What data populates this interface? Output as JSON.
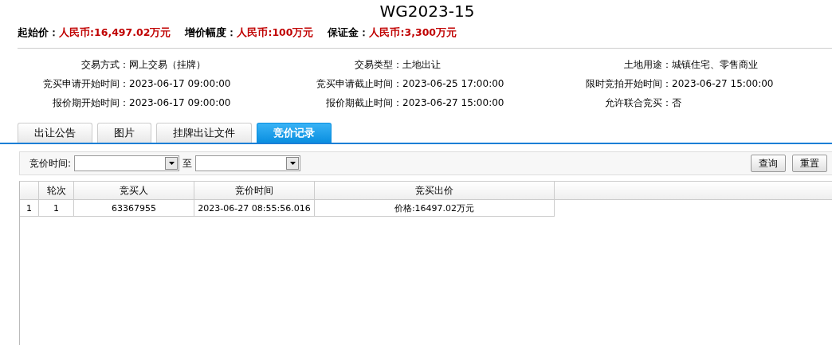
{
  "title": "WG2023-15",
  "prices": [
    {
      "label": "起始价：",
      "value": "人民币:16,497.02万元"
    },
    {
      "label": "增价幅度：",
      "value": "人民币:100万元"
    },
    {
      "label": "保证金：",
      "value": "人民币:3,300万元"
    }
  ],
  "info": [
    {
      "label": "交易方式：",
      "value": "网上交易（挂牌）"
    },
    {
      "label": "交易类型：",
      "value": "土地出让"
    },
    {
      "label": "土地用途：",
      "value": "城镇住宅、零售商业"
    },
    {
      "label": "竞买申请开始时间：",
      "value": "2023-06-17 09:00:00"
    },
    {
      "label": "竞买申请截止时间：",
      "value": "2023-06-25 17:00:00"
    },
    {
      "label": "限时竞拍开始时间：",
      "value": "2023-06-27 15:00:00"
    },
    {
      "label": "报价期开始时间：",
      "value": "2023-06-17 09:00:00"
    },
    {
      "label": "报价期截止时间：",
      "value": "2023-06-27 15:00:00"
    },
    {
      "label": "允许联合竞买：",
      "value": "否"
    }
  ],
  "tabs": [
    {
      "label": "出让公告",
      "selected": false
    },
    {
      "label": "图片",
      "selected": false
    },
    {
      "label": "挂牌出让文件",
      "selected": false
    },
    {
      "label": "竞价记录",
      "selected": true
    }
  ],
  "filter": {
    "label": "竞价时间:",
    "separator": "至",
    "buttons": [
      "查询",
      "重置"
    ]
  },
  "table": {
    "columns": [
      "轮次",
      "竞买人",
      "竞价时间",
      "竞买出价"
    ],
    "rows": [
      {
        "index": "1",
        "cells": [
          "1",
          "63367955",
          "2023-06-27 08:55:56.016",
          "价格:16497.02万元"
        ]
      }
    ]
  }
}
